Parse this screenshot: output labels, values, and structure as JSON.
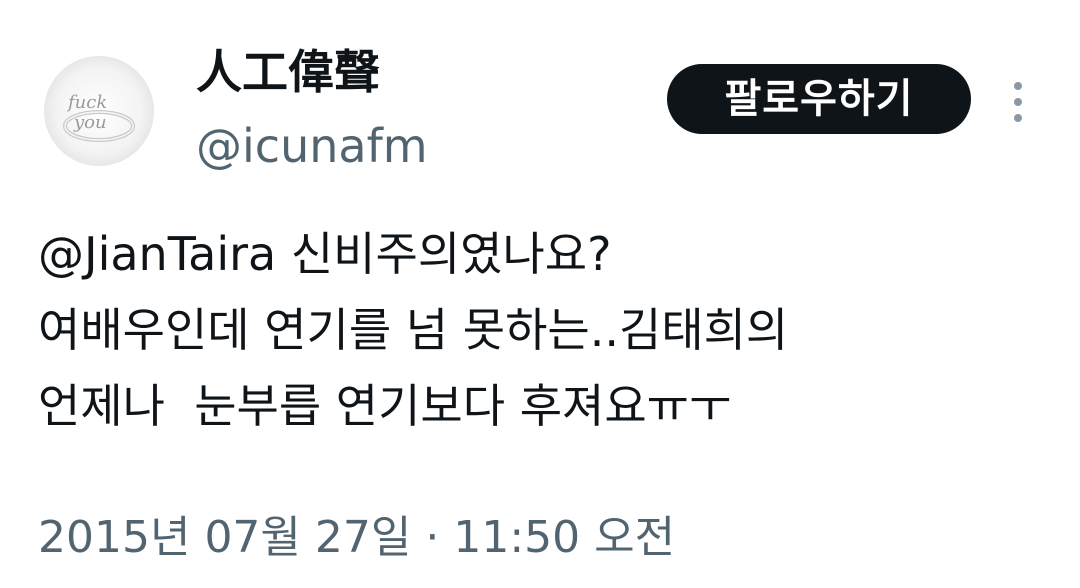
{
  "user": {
    "display_name": "人工偉聲",
    "handle": "@icunafm",
    "avatar_text_top": "fuck",
    "avatar_text_bottom": "you"
  },
  "follow_button": {
    "label": "팔로우하기"
  },
  "more_icon": "vertical-ellipsis-icon",
  "tweet": {
    "lines": [
      "@JianTaira 신비주의였나요?",
      "여배우인데 연기를 넘 못하는..김태희의",
      "언제나  눈부릅 연기보다 후져요ㅠㅜ"
    ]
  },
  "timestamp": "2015년 07월 27일 · 11:50 오전",
  "colors": {
    "text": "#0f1419",
    "secondary": "#536471",
    "button_bg": "#0f1419",
    "button_text": "#ffffff"
  }
}
